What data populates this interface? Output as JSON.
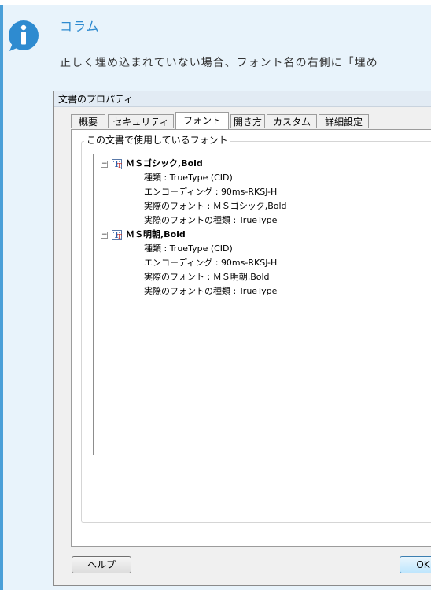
{
  "column": {
    "title": "コラム",
    "text": "正しく埋め込まれていない場合、フォント名の右側に「埋め"
  },
  "dialog": {
    "title": "文書のプロパティ",
    "tabs": [
      "概要",
      "セキュリティ",
      "フォント",
      "開き方",
      "カスタム",
      "詳細設定"
    ],
    "active_tab": "フォント",
    "group_label": "この文書で使用しているフォント",
    "fonts": [
      {
        "name": "ＭＳゴシック,Bold",
        "props": [
          {
            "label": "種類 :",
            "value": "TrueType (CID)"
          },
          {
            "label": "エンコーディング :",
            "value": "90ms-RKSJ-H"
          },
          {
            "label": "実際のフォント :",
            "value": "ＭＳゴシック,Bold"
          },
          {
            "label": "実際のフォントの種類 :",
            "value": "TrueType"
          }
        ]
      },
      {
        "name": "ＭＳ明朝,Bold",
        "props": [
          {
            "label": "種類 :",
            "value": "TrueType (CID)"
          },
          {
            "label": "エンコーディング :",
            "value": "90ms-RKSJ-H"
          },
          {
            "label": "実際のフォント :",
            "value": "ＭＳ明朝,Bold"
          },
          {
            "label": "実際のフォントの種類 :",
            "value": "TrueType"
          }
        ]
      }
    ],
    "help_button": "ヘルプ",
    "ok_button": "OK"
  },
  "colors": {
    "accent": "#2e8bd0",
    "column_bg": "#e8f3fb",
    "bar": "#4a9fd8"
  },
  "icons": [
    "info-icon",
    "collapse-icon",
    "font-icon"
  ]
}
